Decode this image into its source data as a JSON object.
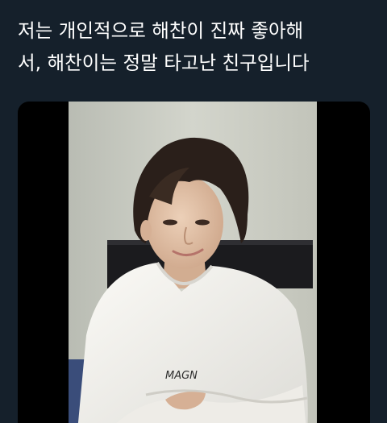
{
  "tweet": {
    "text": "저는 개인적으로 해찬이 진짜 좋아해\n서, 해찬이는 정말 타고난 친구입니다"
  },
  "media": {
    "type": "video-still",
    "shirt_print": "MAGN"
  },
  "colors": {
    "background": "#15202b",
    "text": "#ffffff",
    "letterbox": "#000000",
    "wall": "#c9cbc2",
    "hair": "#2a1f1a",
    "skin": "#e2c2a6",
    "shirt": "#f4f3ef"
  }
}
